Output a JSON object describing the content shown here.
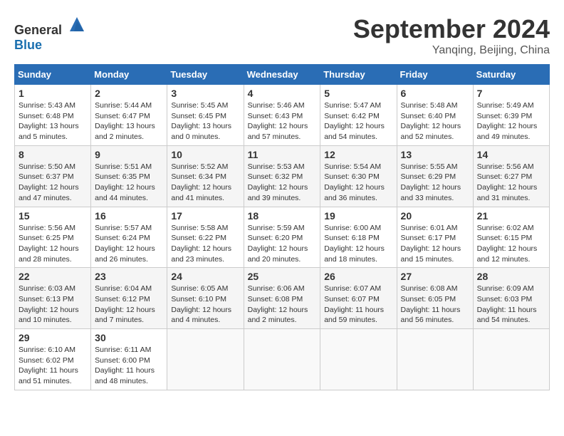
{
  "header": {
    "logo_general": "General",
    "logo_blue": "Blue",
    "month": "September 2024",
    "location": "Yanqing, Beijing, China"
  },
  "days_of_week": [
    "Sunday",
    "Monday",
    "Tuesday",
    "Wednesday",
    "Thursday",
    "Friday",
    "Saturday"
  ],
  "weeks": [
    [
      {
        "day": "1",
        "sunrise": "Sunrise: 5:43 AM",
        "sunset": "Sunset: 6:48 PM",
        "daylight": "Daylight: 13 hours and 5 minutes."
      },
      {
        "day": "2",
        "sunrise": "Sunrise: 5:44 AM",
        "sunset": "Sunset: 6:47 PM",
        "daylight": "Daylight: 13 hours and 2 minutes."
      },
      {
        "day": "3",
        "sunrise": "Sunrise: 5:45 AM",
        "sunset": "Sunset: 6:45 PM",
        "daylight": "Daylight: 13 hours and 0 minutes."
      },
      {
        "day": "4",
        "sunrise": "Sunrise: 5:46 AM",
        "sunset": "Sunset: 6:43 PM",
        "daylight": "Daylight: 12 hours and 57 minutes."
      },
      {
        "day": "5",
        "sunrise": "Sunrise: 5:47 AM",
        "sunset": "Sunset: 6:42 PM",
        "daylight": "Daylight: 12 hours and 54 minutes."
      },
      {
        "day": "6",
        "sunrise": "Sunrise: 5:48 AM",
        "sunset": "Sunset: 6:40 PM",
        "daylight": "Daylight: 12 hours and 52 minutes."
      },
      {
        "day": "7",
        "sunrise": "Sunrise: 5:49 AM",
        "sunset": "Sunset: 6:39 PM",
        "daylight": "Daylight: 12 hours and 49 minutes."
      }
    ],
    [
      {
        "day": "8",
        "sunrise": "Sunrise: 5:50 AM",
        "sunset": "Sunset: 6:37 PM",
        "daylight": "Daylight: 12 hours and 47 minutes."
      },
      {
        "day": "9",
        "sunrise": "Sunrise: 5:51 AM",
        "sunset": "Sunset: 6:35 PM",
        "daylight": "Daylight: 12 hours and 44 minutes."
      },
      {
        "day": "10",
        "sunrise": "Sunrise: 5:52 AM",
        "sunset": "Sunset: 6:34 PM",
        "daylight": "Daylight: 12 hours and 41 minutes."
      },
      {
        "day": "11",
        "sunrise": "Sunrise: 5:53 AM",
        "sunset": "Sunset: 6:32 PM",
        "daylight": "Daylight: 12 hours and 39 minutes."
      },
      {
        "day": "12",
        "sunrise": "Sunrise: 5:54 AM",
        "sunset": "Sunset: 6:30 PM",
        "daylight": "Daylight: 12 hours and 36 minutes."
      },
      {
        "day": "13",
        "sunrise": "Sunrise: 5:55 AM",
        "sunset": "Sunset: 6:29 PM",
        "daylight": "Daylight: 12 hours and 33 minutes."
      },
      {
        "day": "14",
        "sunrise": "Sunrise: 5:56 AM",
        "sunset": "Sunset: 6:27 PM",
        "daylight": "Daylight: 12 hours and 31 minutes."
      }
    ],
    [
      {
        "day": "15",
        "sunrise": "Sunrise: 5:56 AM",
        "sunset": "Sunset: 6:25 PM",
        "daylight": "Daylight: 12 hours and 28 minutes."
      },
      {
        "day": "16",
        "sunrise": "Sunrise: 5:57 AM",
        "sunset": "Sunset: 6:24 PM",
        "daylight": "Daylight: 12 hours and 26 minutes."
      },
      {
        "day": "17",
        "sunrise": "Sunrise: 5:58 AM",
        "sunset": "Sunset: 6:22 PM",
        "daylight": "Daylight: 12 hours and 23 minutes."
      },
      {
        "day": "18",
        "sunrise": "Sunrise: 5:59 AM",
        "sunset": "Sunset: 6:20 PM",
        "daylight": "Daylight: 12 hours and 20 minutes."
      },
      {
        "day": "19",
        "sunrise": "Sunrise: 6:00 AM",
        "sunset": "Sunset: 6:18 PM",
        "daylight": "Daylight: 12 hours and 18 minutes."
      },
      {
        "day": "20",
        "sunrise": "Sunrise: 6:01 AM",
        "sunset": "Sunset: 6:17 PM",
        "daylight": "Daylight: 12 hours and 15 minutes."
      },
      {
        "day": "21",
        "sunrise": "Sunrise: 6:02 AM",
        "sunset": "Sunset: 6:15 PM",
        "daylight": "Daylight: 12 hours and 12 minutes."
      }
    ],
    [
      {
        "day": "22",
        "sunrise": "Sunrise: 6:03 AM",
        "sunset": "Sunset: 6:13 PM",
        "daylight": "Daylight: 12 hours and 10 minutes."
      },
      {
        "day": "23",
        "sunrise": "Sunrise: 6:04 AM",
        "sunset": "Sunset: 6:12 PM",
        "daylight": "Daylight: 12 hours and 7 minutes."
      },
      {
        "day": "24",
        "sunrise": "Sunrise: 6:05 AM",
        "sunset": "Sunset: 6:10 PM",
        "daylight": "Daylight: 12 hours and 4 minutes."
      },
      {
        "day": "25",
        "sunrise": "Sunrise: 6:06 AM",
        "sunset": "Sunset: 6:08 PM",
        "daylight": "Daylight: 12 hours and 2 minutes."
      },
      {
        "day": "26",
        "sunrise": "Sunrise: 6:07 AM",
        "sunset": "Sunset: 6:07 PM",
        "daylight": "Daylight: 11 hours and 59 minutes."
      },
      {
        "day": "27",
        "sunrise": "Sunrise: 6:08 AM",
        "sunset": "Sunset: 6:05 PM",
        "daylight": "Daylight: 11 hours and 56 minutes."
      },
      {
        "day": "28",
        "sunrise": "Sunrise: 6:09 AM",
        "sunset": "Sunset: 6:03 PM",
        "daylight": "Daylight: 11 hours and 54 minutes."
      }
    ],
    [
      {
        "day": "29",
        "sunrise": "Sunrise: 6:10 AM",
        "sunset": "Sunset: 6:02 PM",
        "daylight": "Daylight: 11 hours and 51 minutes."
      },
      {
        "day": "30",
        "sunrise": "Sunrise: 6:11 AM",
        "sunset": "Sunset: 6:00 PM",
        "daylight": "Daylight: 11 hours and 48 minutes."
      },
      null,
      null,
      null,
      null,
      null
    ]
  ]
}
